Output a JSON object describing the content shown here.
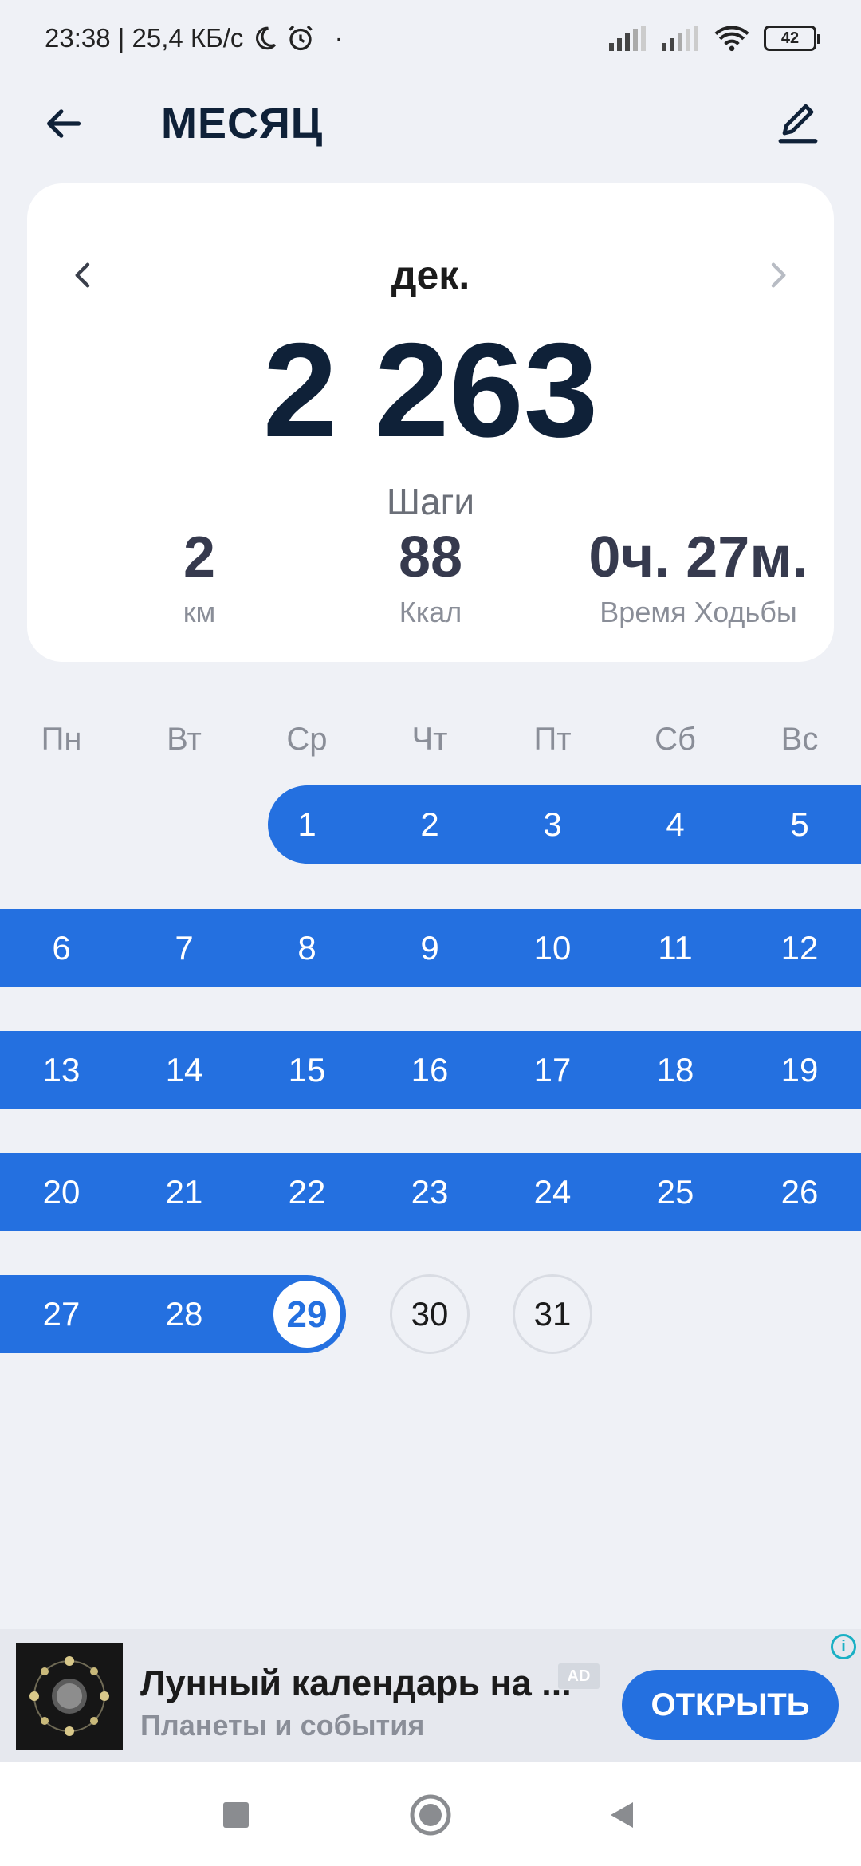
{
  "status_bar": {
    "time_speed": "23:38 | 25,4 КБ/с",
    "dot": "·",
    "battery": "42"
  },
  "header": {
    "title": "МЕСЯЦ"
  },
  "summary": {
    "month": "дек.",
    "steps_value": "2 263",
    "steps_label": "Шаги",
    "distance_value": "2",
    "distance_label": "км",
    "calories_value": "88",
    "calories_label": "Ккал",
    "time_value": "0ч. 27м.",
    "time_label": "Время Ходьбы"
  },
  "calendar": {
    "weekdays": [
      "Пн",
      "Вт",
      "Ср",
      "Чт",
      "Пт",
      "Сб",
      "Вс"
    ],
    "rows": [
      [
        "",
        "",
        "1",
        "2",
        "3",
        "4",
        "5"
      ],
      [
        "6",
        "7",
        "8",
        "9",
        "10",
        "11",
        "12"
      ],
      [
        "13",
        "14",
        "15",
        "16",
        "17",
        "18",
        "19"
      ],
      [
        "20",
        "21",
        "22",
        "23",
        "24",
        "25",
        "26"
      ],
      [
        "27",
        "28",
        "29",
        "30",
        "31",
        "",
        ""
      ]
    ],
    "today": "29",
    "future_days": [
      "30",
      "31"
    ],
    "accent_color": "#2470e0"
  },
  "ad": {
    "title": "Лунный календарь на ...",
    "badge": "AD",
    "subtitle": "Планеты и события",
    "button_label": "ОТКРЫТЬ",
    "info": "i"
  }
}
